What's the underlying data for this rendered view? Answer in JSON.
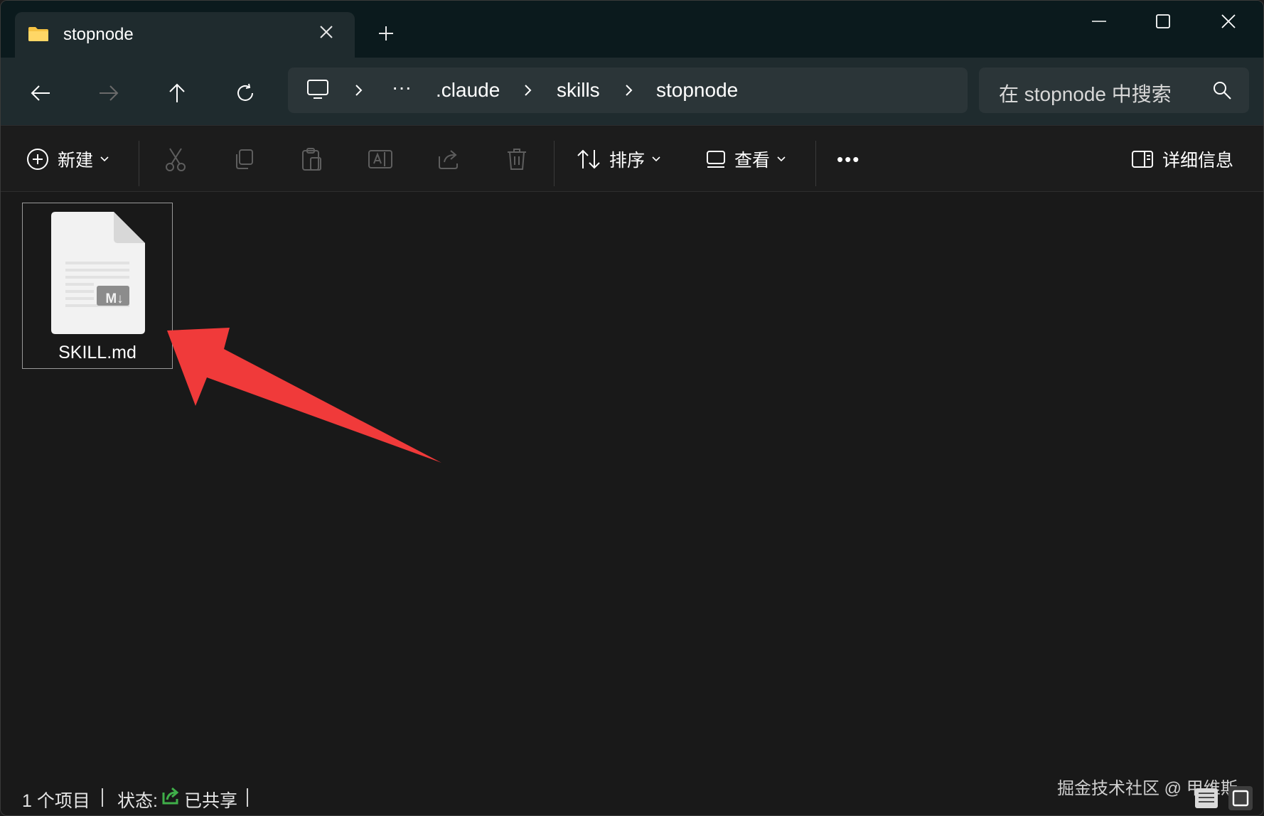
{
  "tab": {
    "title": "stopnode",
    "folder_icon": "folder-icon",
    "close_icon": "close-icon"
  },
  "new_tab_icon": "plus-icon",
  "window_controls": {
    "minimize": "minimize-icon",
    "maximize": "maximize-icon",
    "close": "close-icon"
  },
  "nav": {
    "back": "back-arrow-icon",
    "forward": "forward-arrow-icon",
    "up": "up-arrow-icon",
    "refresh": "refresh-icon"
  },
  "breadcrumb": {
    "root_icon": "monitor-icon",
    "ellipsis": "···",
    "items": [
      ".claude",
      "skills",
      "stopnode"
    ]
  },
  "search": {
    "placeholder": "在 stopnode 中搜索",
    "icon": "search-icon"
  },
  "commandbar": {
    "new_label": "新建",
    "sort_label": "排序",
    "view_label": "查看",
    "more_label": "•••",
    "details_label": "详细信息",
    "icons": [
      "cut-icon",
      "copy-icon",
      "paste-icon",
      "rename-icon",
      "share-icon",
      "delete-icon"
    ]
  },
  "files": [
    {
      "name": "SKILL.md",
      "icon": "markdown-file-icon",
      "badge": "M↓"
    }
  ],
  "status": {
    "count": "1 个项目",
    "state_label": "状态:",
    "state_value": "已共享"
  },
  "watermark": "掘金技术社区 @ 甲维斯",
  "colors": {
    "accent_arrow": "#f03a3a",
    "shared_icon": "#3fae49",
    "folder": "#f6c343"
  }
}
